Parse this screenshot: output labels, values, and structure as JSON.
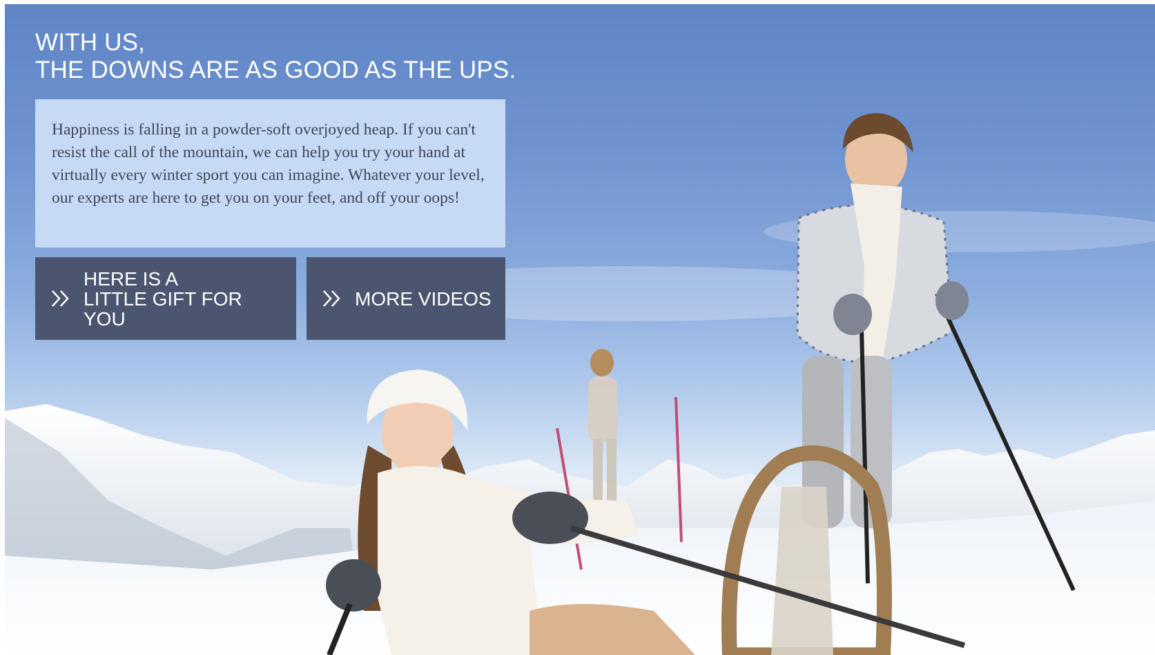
{
  "hero": {
    "headline_line1": "WITH US,",
    "headline_line2": "THE DOWNS ARE AS GOOD AS THE UPS.",
    "body": "Happiness is falling in a powder-soft overjoyed heap. If you can't resist the call of the mountain, we can help you try your hand at virtually every winter sport you can imagine. Whatever your level, our experts are here to get you on your feet, and off your oops!"
  },
  "buttons": {
    "gift_label": "HERE IS A LITTLE GIFT FOR YOU",
    "videos_label": "MORE VIDEOS"
  },
  "icons": {
    "button_icon": "double-chevron-right-icon"
  },
  "colors": {
    "copy_box_bg": "#c7daf5",
    "button_bg": "#4c5570",
    "sky": "#6f93cf"
  }
}
